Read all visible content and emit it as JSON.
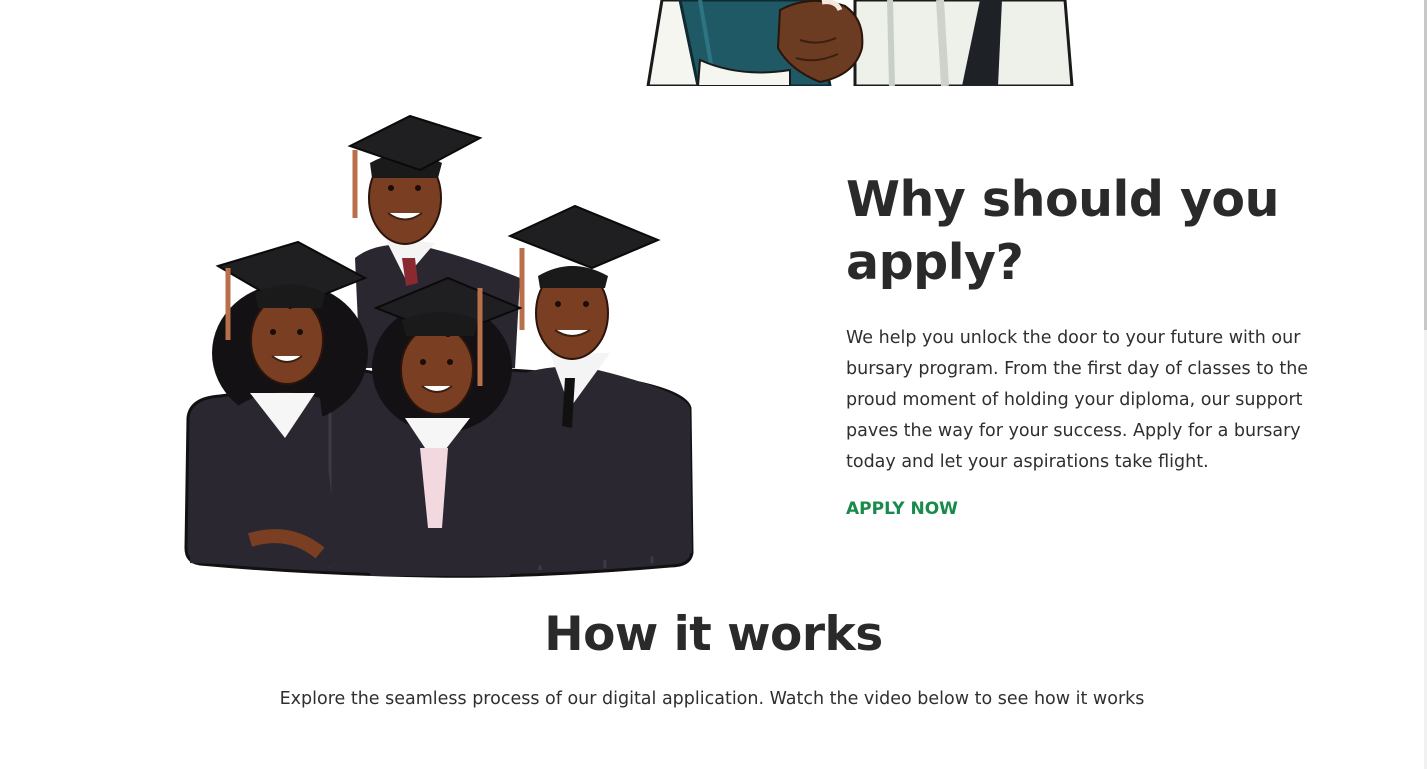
{
  "why_section": {
    "heading": "Why should you apply?",
    "paragraph": "We help you unlock the door to your future with our bursary program. From the first day of classes to the proud moment of holding your diploma, our support paves the way for your success. Apply for a bursary today and let your aspirations take flight.",
    "cta_label": "APPLY NOW"
  },
  "how_section": {
    "heading": "How it works",
    "paragraph": "Explore the seamless process of our digital application. Watch the video below to see how it works"
  },
  "colors": {
    "accent_green": "#1a8a4a",
    "heading_text": "#2a2a2a",
    "body_text": "#2f2f2f",
    "gown": "#2b2730",
    "skin": "#7a3f22"
  }
}
